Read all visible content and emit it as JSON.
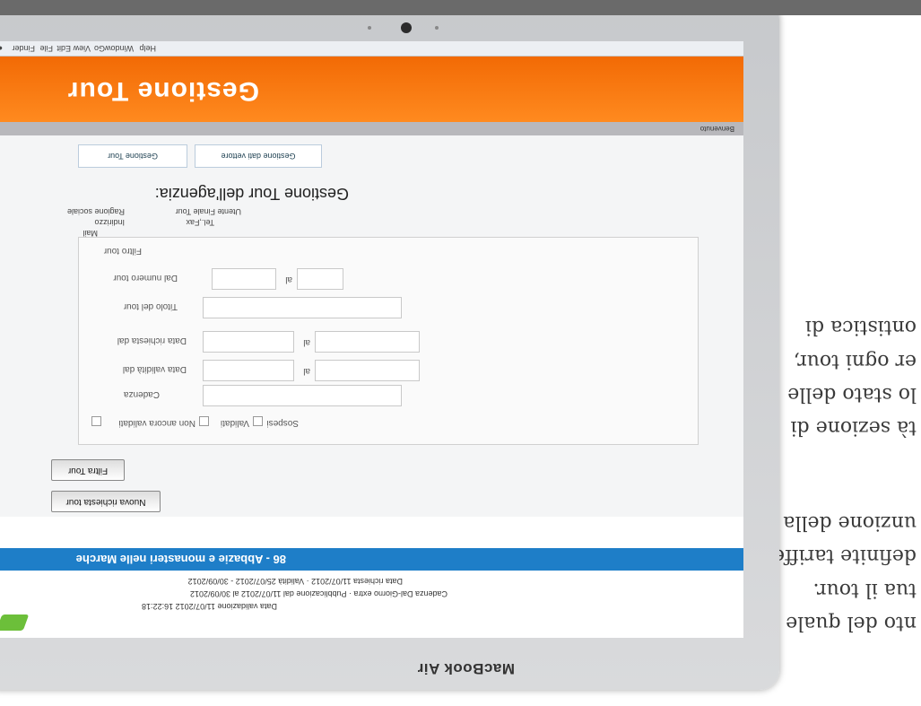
{
  "printed_page": {
    "lines": [
      "nto del quale si",
      "tua il tour.",
      "definite tariffe",
      "unzione della",
      "tà sezione di",
      "lo stato delle",
      "er ogni tour,",
      "ontistica di"
    ]
  },
  "laptop": {
    "brand": "MacBook Air"
  },
  "menubar": {
    "items": [
      "Finder",
      "File",
      "Edit",
      "View",
      "Go",
      "Window",
      "Help"
    ]
  },
  "app": {
    "title": "Gestione Tour",
    "welcome": "Benvenuto",
    "tabs": [
      "Gestione Tour",
      "Gestione dati vettore"
    ],
    "section_title": "Gestione Tour dell'agenzia:",
    "agency": {
      "labels": [
        "Ragione sociale",
        "Indirizzo",
        "Mail"
      ],
      "values": [
        "Utente Finale Tour",
        "Tel.,Fax"
      ]
    },
    "filter": {
      "heading": "Filtro tour",
      "fields": [
        "Dal numero tour",
        "Titolo del tour",
        "Data richiesta dal",
        "Data validità dal",
        "Cadenza"
      ],
      "al": "al",
      "checks": [
        "Non ancora validati",
        "Validati",
        "Sospesi"
      ],
      "filter_button": "Filtra Tour",
      "new_button": "Nuova richiesta tour"
    },
    "tour": {
      "title": "86 - Abbazie e monasteri nelle Marche",
      "line1": "Data richiesta 11/07/2012 · Validità 25/07/2012 - 30/09/2012",
      "line2": "Cadenza Dal-Giorno extra · Pubblicazione dal 11/07/2012 al 30/09/2012",
      "line3": "Data validazione 11/07/2012 16:22:18"
    }
  }
}
